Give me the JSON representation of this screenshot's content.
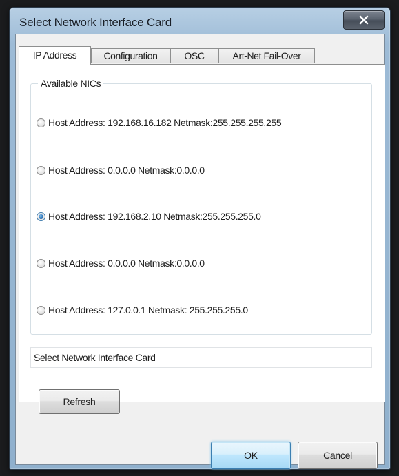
{
  "window": {
    "title": "Select Network Interface Card",
    "close_glyph": "✕"
  },
  "tabs": [
    {
      "label": "IP Address",
      "active": true
    },
    {
      "label": "Configuration",
      "active": false
    },
    {
      "label": "OSC",
      "active": false
    },
    {
      "label": "Art-Net Fail-Over",
      "active": false
    }
  ],
  "nics": {
    "group_title": "Available NICs",
    "items": [
      {
        "label": "Host Address: 192.168.16.182 Netmask:255.255.255.255",
        "selected": false
      },
      {
        "label": "Host Address: 0.0.0.0 Netmask:0.0.0.0",
        "selected": false
      },
      {
        "label": "Host Address: 192.168.2.10 Netmask:255.255.255.0",
        "selected": true
      },
      {
        "label": "Host Address: 0.0.0.0 Netmask:0.0.0.0",
        "selected": false
      },
      {
        "label": "Host Address: 127.0.0.1 Netmask: 255.255.255.0",
        "selected": false
      }
    ]
  },
  "status_text": "Select Network Interface Card",
  "buttons": {
    "refresh": "Refresh",
    "ok": "OK",
    "cancel": "Cancel"
  },
  "icons": {
    "close": "close-icon"
  }
}
